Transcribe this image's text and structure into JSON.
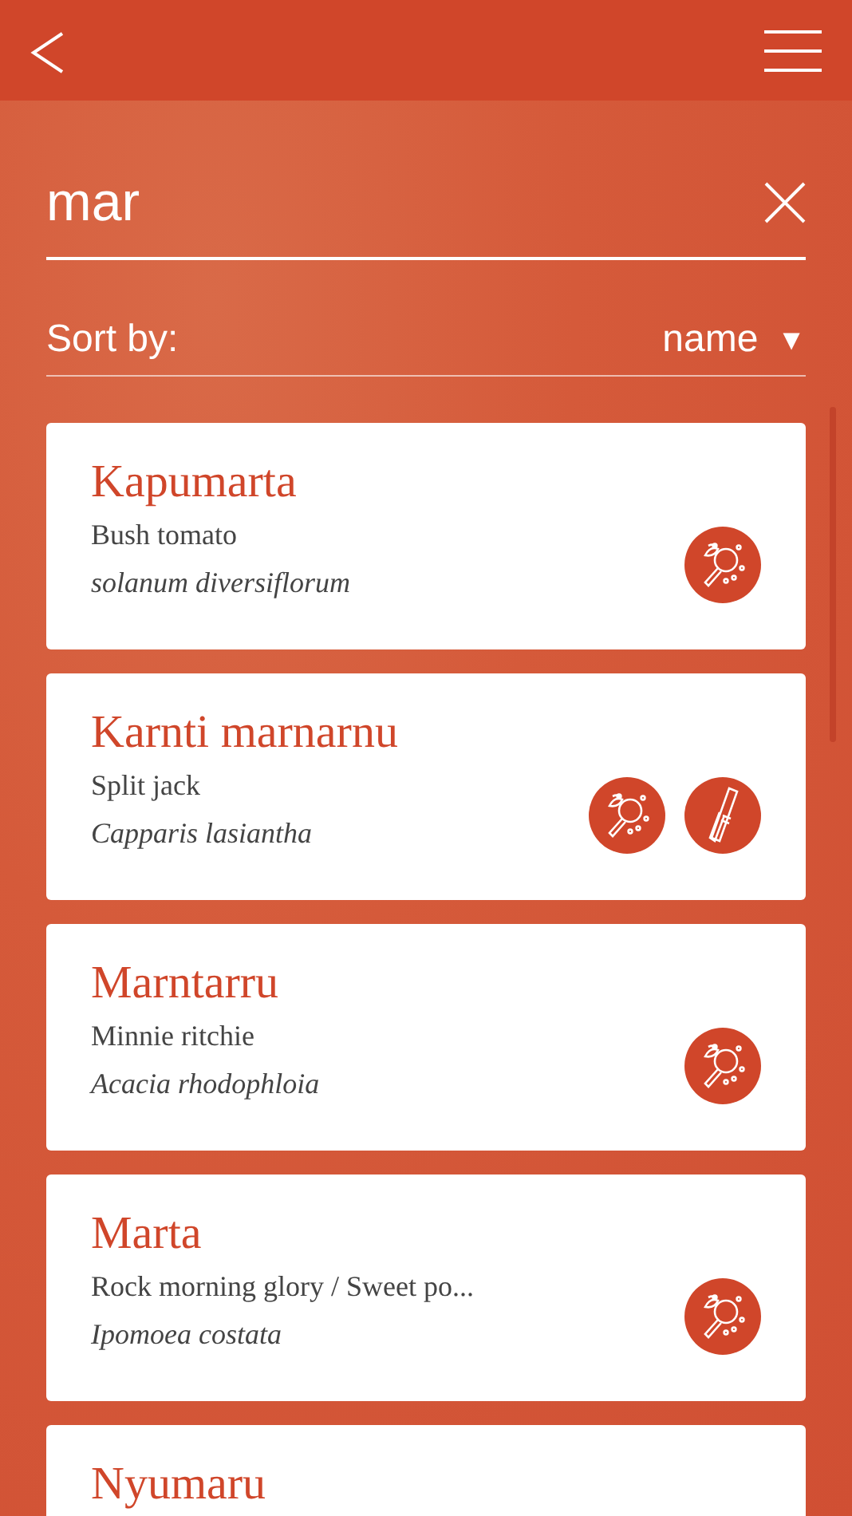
{
  "search": {
    "value": "mar"
  },
  "sort": {
    "label": "Sort by:",
    "value": "name",
    "caret": "▼"
  },
  "results": [
    {
      "name": "Kapumarta",
      "common": "Bush tomato",
      "scientific": "solanum diversiflorum",
      "uses": [
        {
          "kind": "food"
        }
      ]
    },
    {
      "name": "Karnti marnarnu",
      "common": "Split jack",
      "scientific": "Capparis lasiantha",
      "uses": [
        {
          "kind": "food"
        },
        {
          "kind": "tool"
        }
      ]
    },
    {
      "name": "Marntarru",
      "common": "Minnie ritchie",
      "scientific": "Acacia rhodophloia",
      "uses": [
        {
          "kind": "food"
        }
      ]
    },
    {
      "name": "Marta",
      "common": "Rock morning glory / Sweet po...",
      "scientific": "Ipomoea costata",
      "uses": [
        {
          "kind": "food"
        }
      ]
    },
    {
      "name": "Nyumaru"
    }
  ]
}
